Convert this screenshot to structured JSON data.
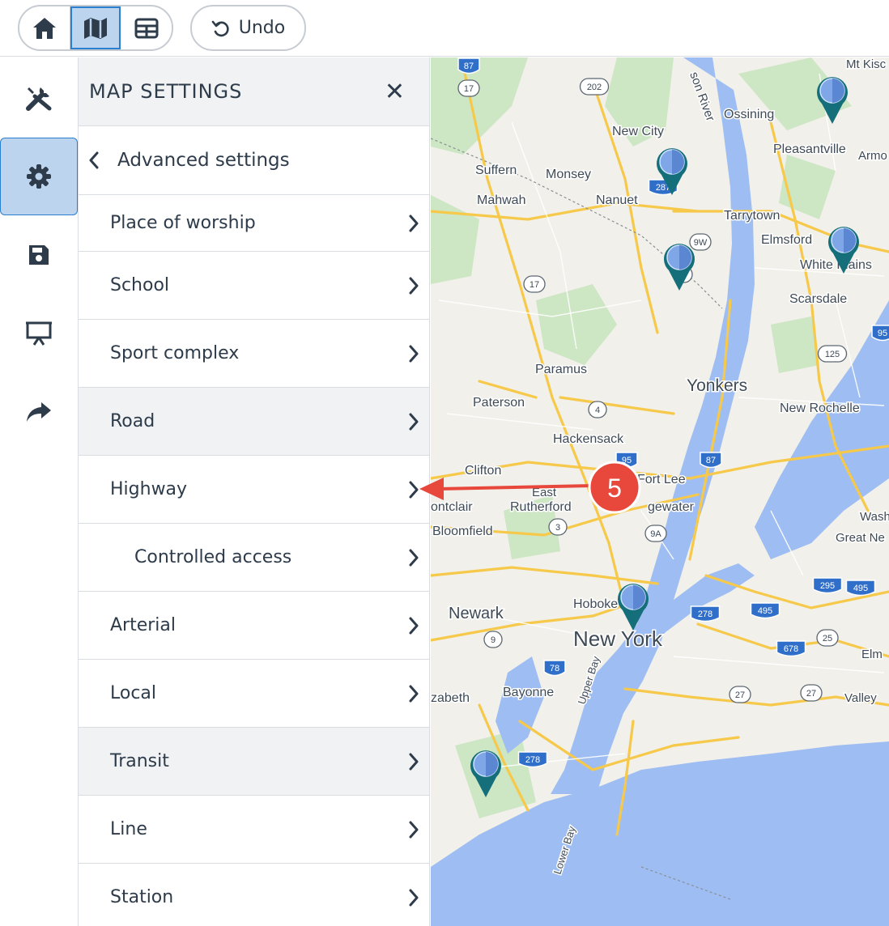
{
  "toolbar": {
    "home_icon": "home-icon",
    "map_icon": "map-icon",
    "table_icon": "table-icon",
    "undo_label": "Undo"
  },
  "rail": {
    "items": [
      "tools-icon",
      "gear-icon",
      "save-icon",
      "presentation-icon",
      "share-icon"
    ],
    "active": "gear-icon"
  },
  "panel": {
    "title": "MAP SETTINGS",
    "back_label": "Advanced settings",
    "items": [
      {
        "label": "Place of worship",
        "shaded": false,
        "sub": false
      },
      {
        "label": "School",
        "shaded": false,
        "sub": false
      },
      {
        "label": "Sport complex",
        "shaded": false,
        "sub": false
      },
      {
        "label": "Road",
        "shaded": true,
        "sub": false
      },
      {
        "label": "Highway",
        "shaded": false,
        "sub": false
      },
      {
        "label": "Controlled access",
        "shaded": false,
        "sub": true
      },
      {
        "label": "Arterial",
        "shaded": false,
        "sub": false
      },
      {
        "label": "Local",
        "shaded": false,
        "sub": false
      },
      {
        "label": "Transit",
        "shaded": true,
        "sub": false
      },
      {
        "label": "Line",
        "shaded": false,
        "sub": false
      },
      {
        "label": "Station",
        "shaded": false,
        "sub": false
      }
    ]
  },
  "map": {
    "places": [
      "Mt Kisc",
      "Ossining",
      "New City",
      "Pleasantville",
      "Armo",
      "Suffern",
      "Monsey",
      "Mahwah",
      "Nanuet",
      "Tarrytown",
      "Elmsford",
      "White Plains",
      "Scarsdale",
      "Paramus",
      "Yonkers",
      "Paterson",
      "New Rochelle",
      "Hackensack",
      "Clifton",
      "Fort Lee",
      "Rutherford",
      "ontclair",
      "gewater",
      "Bloomfield",
      "Wash",
      "Great Ne",
      "Newark",
      "Hoboke",
      "New York",
      "Elm",
      "zabeth",
      "Bayonne",
      "Valley",
      "Upper Bay",
      "Lower Bay",
      "son River",
      "East"
    ],
    "shields": [
      "87",
      "17",
      "202",
      "287",
      "9W",
      "17",
      "9",
      "4",
      "95",
      "87",
      "3",
      "9A",
      "125",
      "95",
      "295",
      "495",
      "278",
      "495",
      "678",
      "25",
      "78",
      "27",
      "27",
      "278",
      "9"
    ]
  },
  "annotation": {
    "number": "5",
    "color": "#e8473b"
  }
}
